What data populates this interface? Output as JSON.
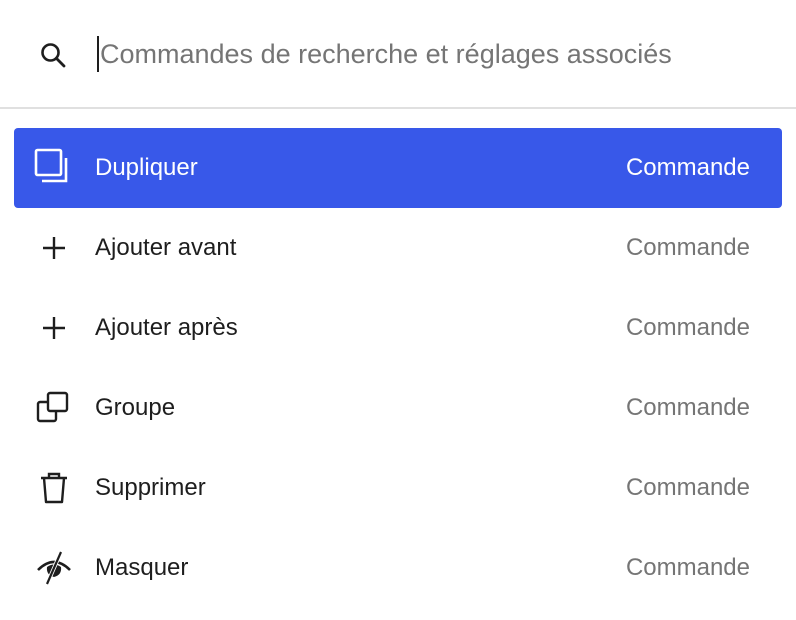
{
  "search": {
    "value": "",
    "placeholder": "Commandes de recherche et réglages associés"
  },
  "results": [
    {
      "label": "Dupliquer",
      "kind": "Commande",
      "icon": "duplicate-icon",
      "selected": true
    },
    {
      "label": "Ajouter avant",
      "kind": "Commande",
      "icon": "plus-icon",
      "selected": false
    },
    {
      "label": "Ajouter après",
      "kind": "Commande",
      "icon": "plus-icon",
      "selected": false
    },
    {
      "label": "Groupe",
      "kind": "Commande",
      "icon": "group-icon",
      "selected": false
    },
    {
      "label": "Supprimer",
      "kind": "Commande",
      "icon": "trash-icon",
      "selected": false
    },
    {
      "label": "Masquer",
      "kind": "Commande",
      "icon": "hidden-eye-icon",
      "selected": false
    }
  ],
  "colors": {
    "accent": "#3858e9",
    "text": "#1e1e1e",
    "muted": "#757575",
    "divider": "#e0e0e0"
  }
}
